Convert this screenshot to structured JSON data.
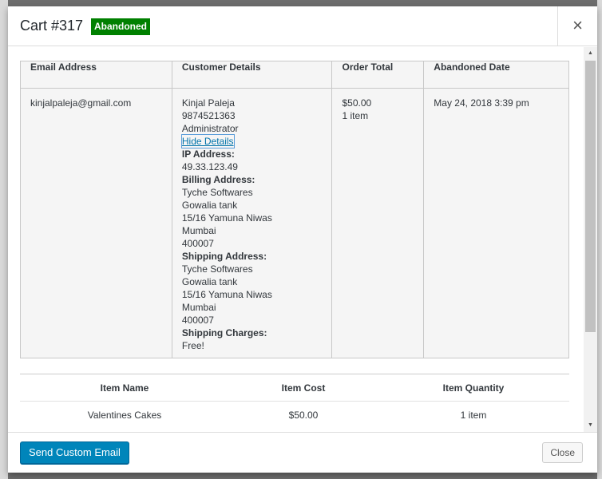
{
  "header": {
    "title": "Cart #317",
    "status": "Abandoned",
    "close_glyph": "×"
  },
  "details_table": {
    "headers": [
      "Email Address",
      "Customer Details",
      "Order Total",
      "Abandoned Date"
    ],
    "email": "kinjalpaleja@gmail.com",
    "customer": {
      "name": "Kinjal Paleja",
      "phone": "9874521363",
      "role": "Administrator",
      "hide_details_link": "Hide Details",
      "ip_label": "IP Address:",
      "ip": "49.33.123.49",
      "billing_label": "Billing Address:",
      "billing": [
        "Tyche Softwares",
        "Gowalia tank",
        "15/16 Yamuna Niwas",
        "Mumbai",
        "400007"
      ],
      "shipping_label": "Shipping Address:",
      "shipping": [
        "Tyche Softwares",
        "Gowalia tank",
        "15/16 Yamuna Niwas",
        "Mumbai",
        "400007"
      ],
      "shipping_charges_label": "Shipping Charges:",
      "shipping_charges": "Free!"
    },
    "order_total": "$50.00",
    "order_items": "1 item",
    "abandoned_date": "May 24, 2018 3:39 pm"
  },
  "items_table": {
    "headers": [
      "Item Name",
      "Item Cost",
      "Item Quantity"
    ],
    "rows": [
      [
        "Valentines Cakes",
        "$50.00",
        "1 item"
      ]
    ]
  },
  "footer": {
    "send_email_label": "Send Custom Email",
    "close_label": "Close"
  },
  "colors": {
    "status_badge": "#008000",
    "primary_button": "#0085ba"
  }
}
